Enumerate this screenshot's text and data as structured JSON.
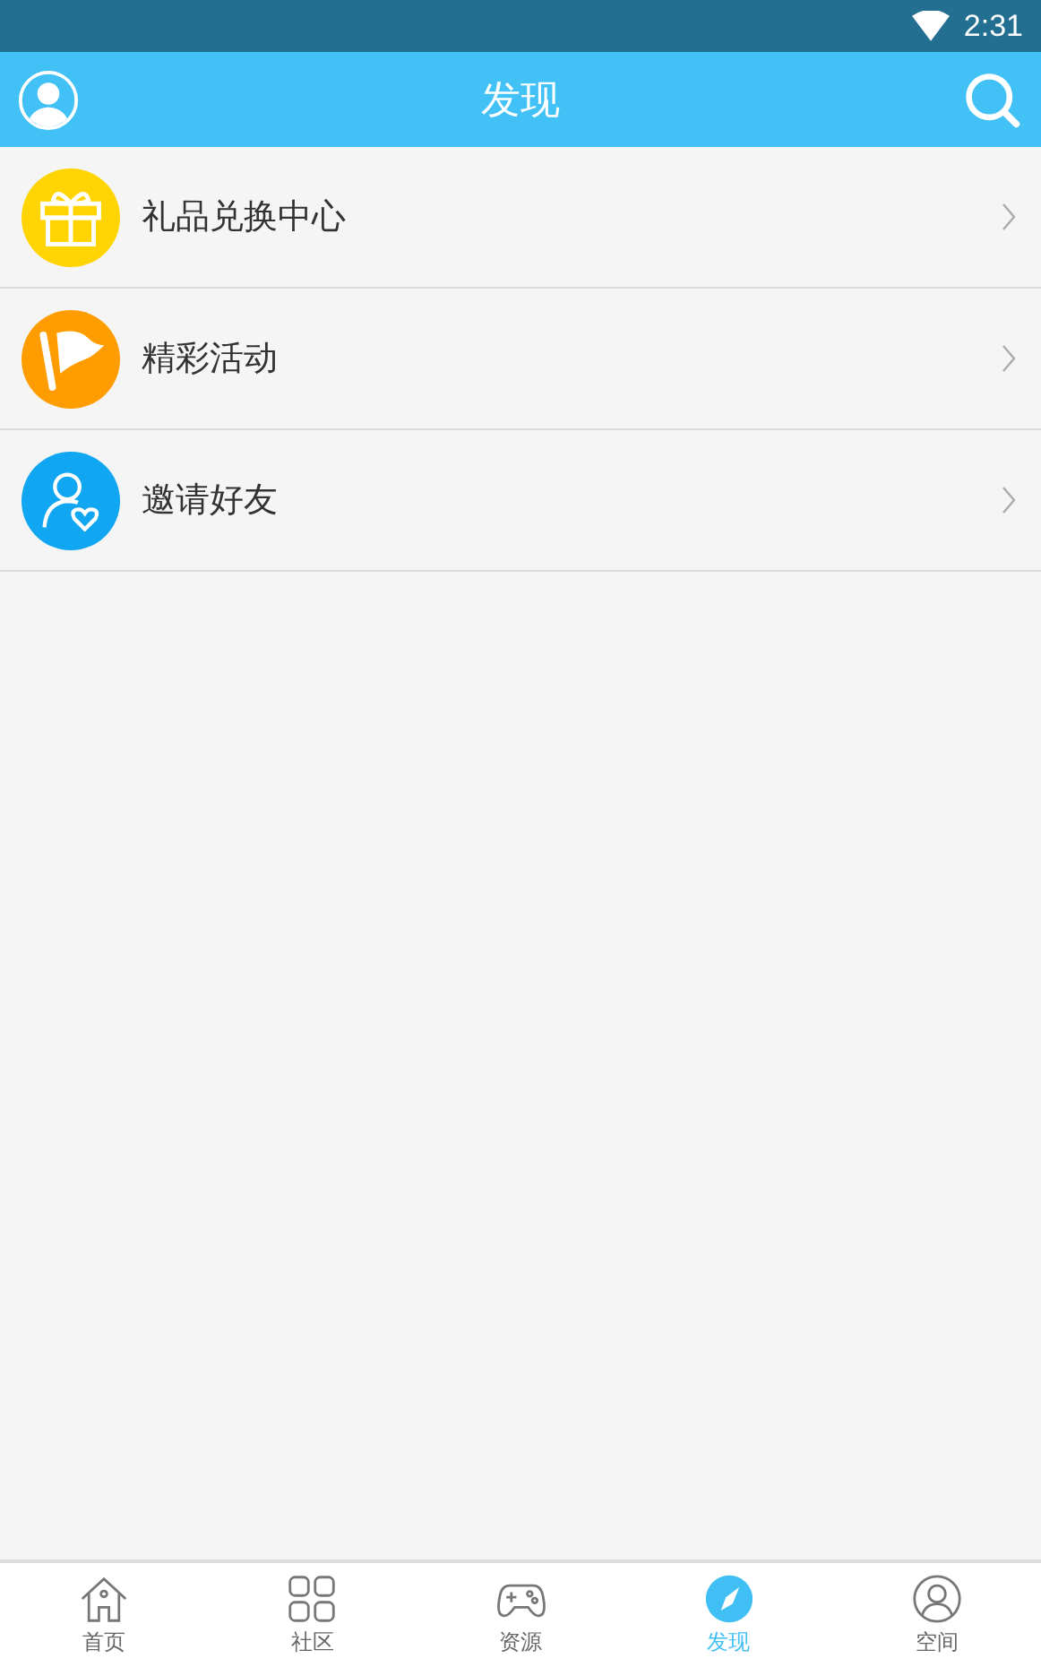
{
  "status_bar": {
    "time": "2:31"
  },
  "header": {
    "title": "发现"
  },
  "items": [
    {
      "kind": "gift",
      "label": "礼品兑换中心",
      "color": "#ffd400"
    },
    {
      "kind": "flag",
      "label": "精彩活动",
      "color": "#ff9c00"
    },
    {
      "kind": "invite",
      "label": "邀请好友",
      "color": "#10a6f2"
    }
  ],
  "tabs": [
    {
      "kind": "home",
      "label": "首页",
      "selected": false
    },
    {
      "kind": "community",
      "label": "社区",
      "selected": false
    },
    {
      "kind": "games",
      "label": "资源",
      "selected": false
    },
    {
      "kind": "discover",
      "label": "发现",
      "selected": true
    },
    {
      "kind": "space",
      "label": "空间",
      "selected": false
    }
  ]
}
